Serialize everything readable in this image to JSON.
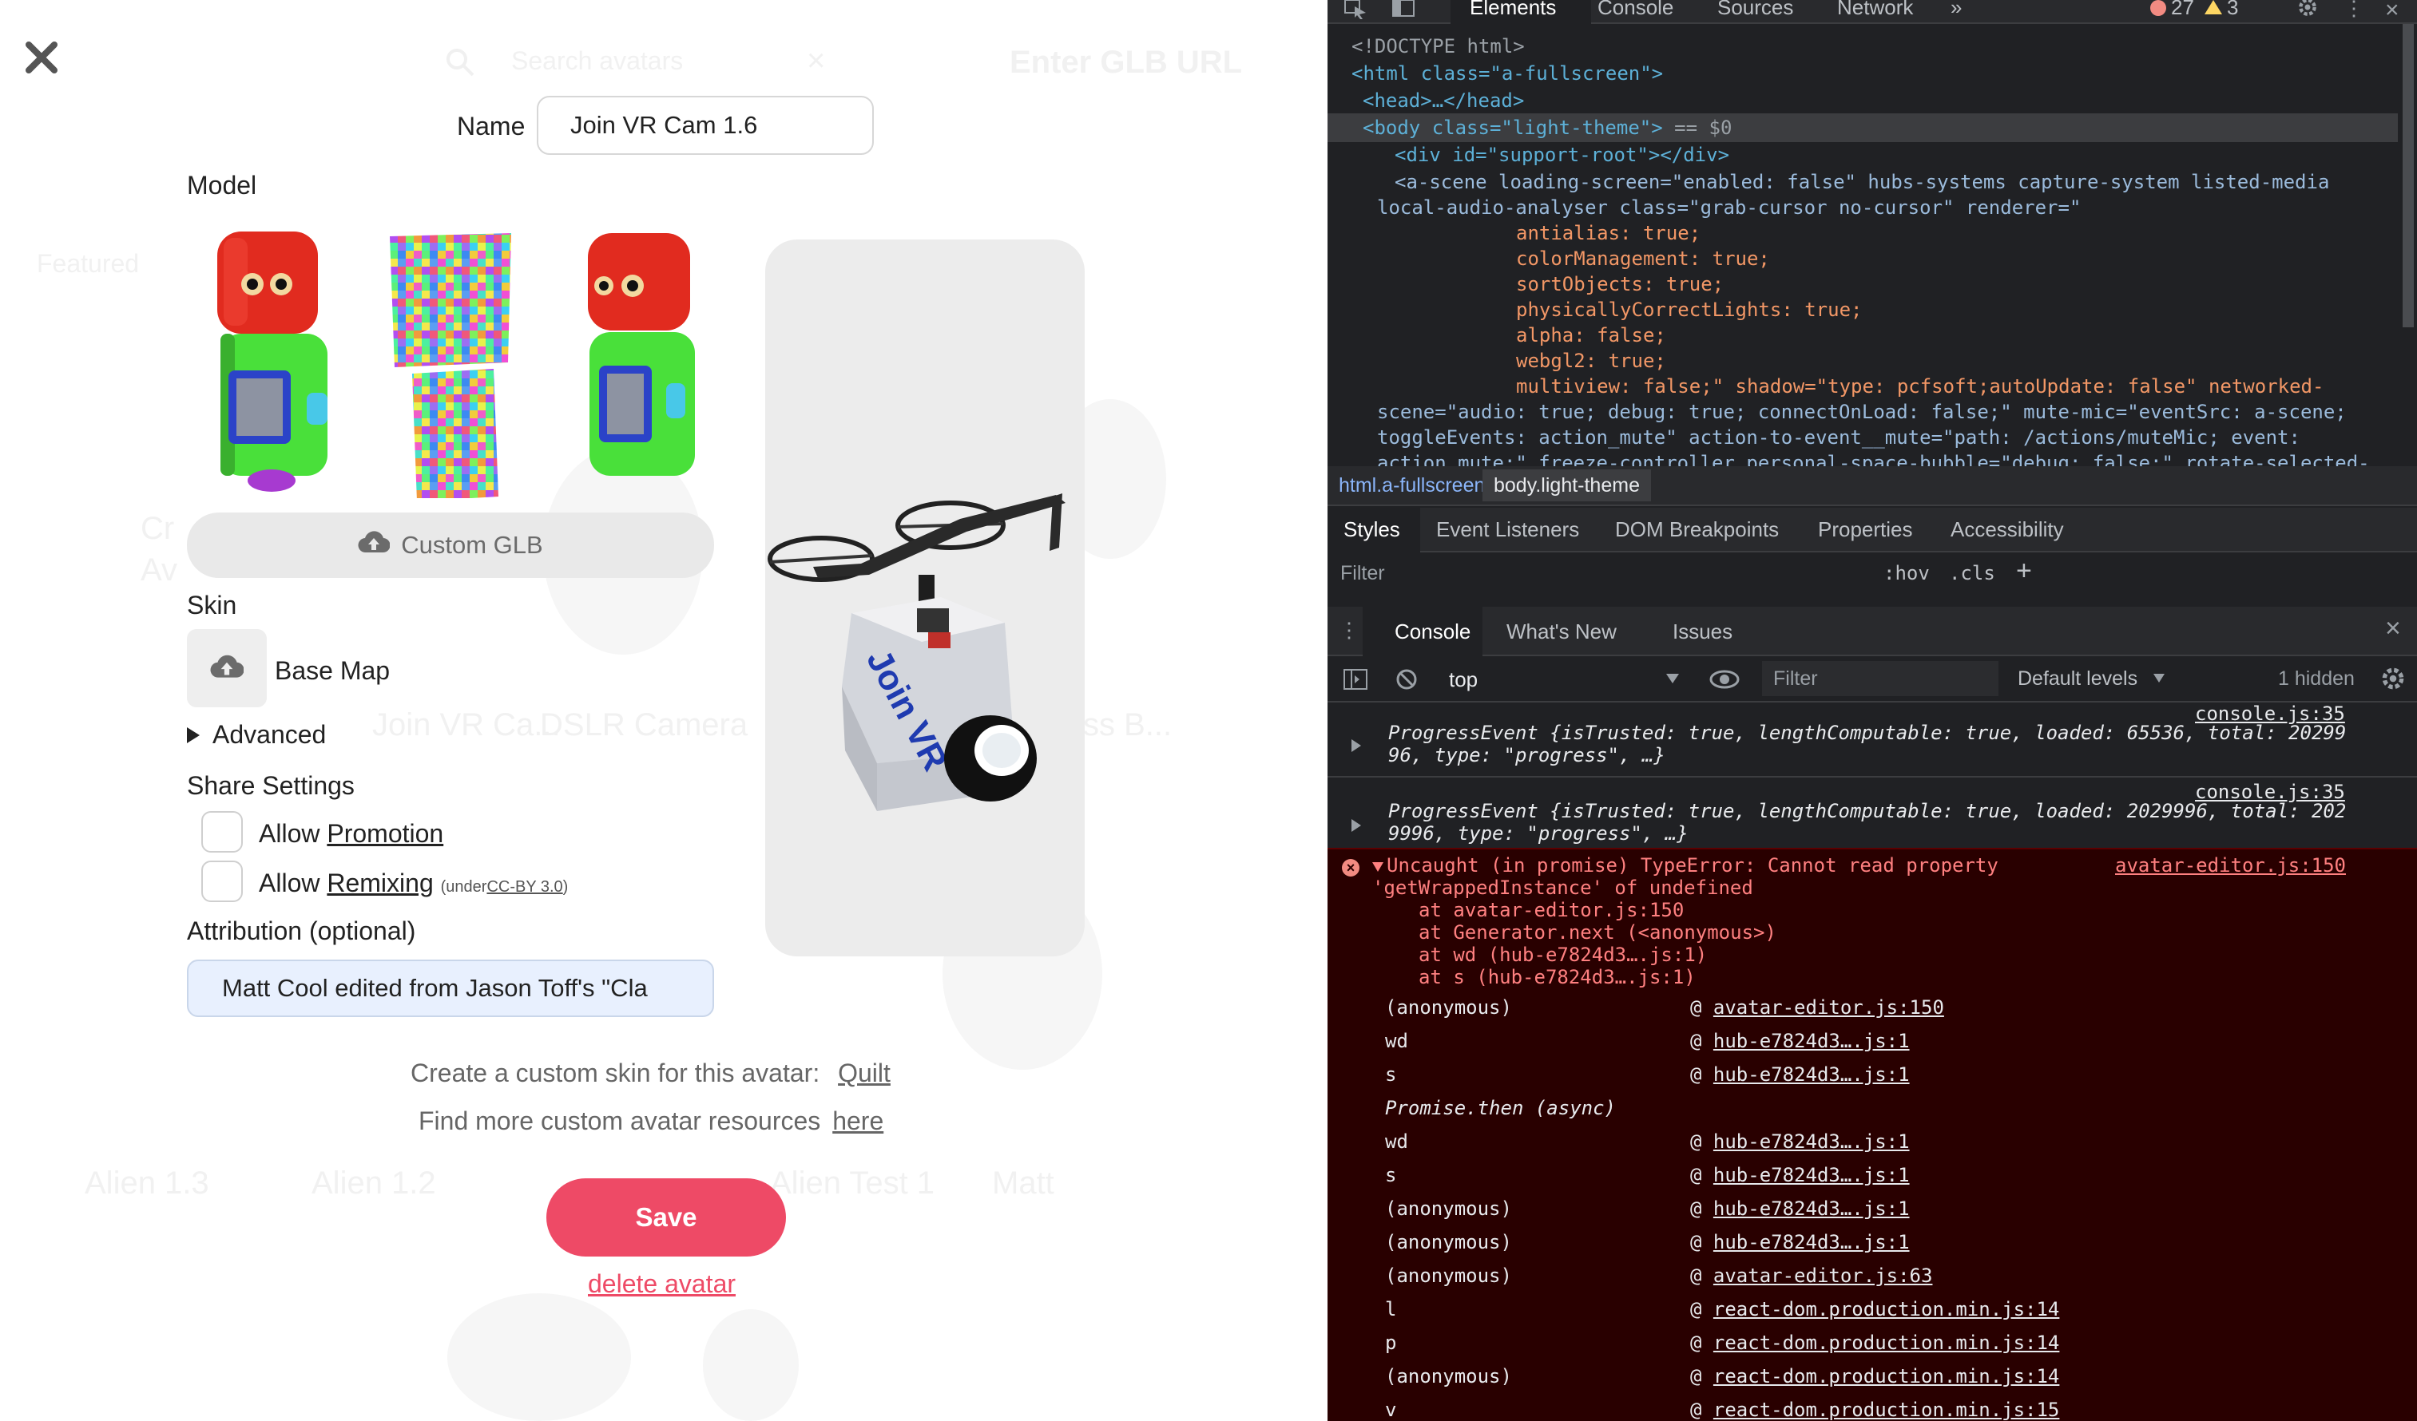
{
  "editor": {
    "name_label": "Name",
    "name_value": "Join VR Cam 1.6",
    "model_label": "Model",
    "custom_glb_label": "Custom GLB",
    "skin_label": "Skin",
    "base_map_label": "Base Map",
    "advanced_label": "Advanced",
    "share_settings_label": "Share Settings",
    "allow_label": "Allow",
    "promotion_label": "Promotion",
    "remixing_label": "Remixing",
    "under_label": "(under",
    "license_label": "CC-BY 3.0",
    "close_paren": ")",
    "attribution_label": "Attribution (optional)",
    "attribution_value": "Matt Cool edited from Jason Toff's \"Cla",
    "skin_prompt": "Create a custom skin for this avatar:",
    "skin_link": "Quilt",
    "resources_prompt": "Find more custom avatar resources",
    "resources_link": "here",
    "save_label": "Save",
    "delete_label": "delete avatar",
    "preview_label": "Join VR"
  },
  "background_ghost": {
    "search_placeholder": "Search avatars",
    "url_button": "Enter GLB URL",
    "row1": [
      "Join VR Ca...",
      "DSLR Camera",
      "ss B..."
    ],
    "row2": [
      "Alien 1.3",
      "Alien 1.2",
      "Alien Test 1",
      "Matt"
    ],
    "fragments": [
      "Cr",
      "Av",
      "Featured"
    ]
  },
  "devtools": {
    "tabs": [
      "Elements",
      "Console",
      "Sources",
      "Network",
      "»"
    ],
    "error_count": "27",
    "warning_count": "3",
    "elements_lines": {
      "doctype": "<!DOCTYPE html>",
      "html_open": "<html class=\"a-fullscreen\">",
      "head": "<head>…</head>",
      "body": "<body class=\"light-theme\">",
      "body_suffix": "== $0",
      "support_root": "<div id=\"support-root\"></div>",
      "scene1": "<a-scene loading-screen=\"enabled: false\" hubs-systems capture-system listed-media",
      "scene2": "local-audio-analyser class=\"grab-cursor no-cursor\" renderer=\"",
      "r1": "antialias: true;",
      "r2": "colorManagement: true;",
      "r3": "sortObjects: true;",
      "r4": "physicallyCorrectLights: true;",
      "r5": "alpha: false;",
      "r6": "webgl2: true;",
      "r7": "multiview: false;\" shadow=\"type: pcfsoft;autoUpdate: false\" networked-",
      "r8": "scene=\"audio: true; debug: true; connectOnLoad: false;\" mute-mic=\"eventSrc: a-scene;",
      "r9": "toggleEvents: action_mute\" action-to-event__mute=\"path: /actions/muteMic; event:",
      "r10": "action_mute;\" freeze-controller personal-space-bubble=\"debug: false;\" rotate-selected-"
    },
    "breadcrumbs": [
      "html.a-fullscreen",
      "body.light-theme"
    ],
    "panel_tabs": [
      "Styles",
      "Event Listeners",
      "DOM Breakpoints",
      "Properties",
      "Accessibility"
    ],
    "filter_placeholder": "Filter",
    "hov": ":hov",
    "cls": ".cls",
    "drawer_tabs": [
      "Console",
      "What's New",
      "Issues"
    ],
    "context": "top",
    "console_filter_placeholder": "Filter",
    "levels": "Default levels",
    "hidden": "1 hidden",
    "console": {
      "src1": "console.js:35",
      "p1a": "ProgressEvent {isTrusted: true, lengthComputable: true, loaded: 65536, total: 20299",
      "p1b": "96, type: \"progress\", …}",
      "src2": "console.js:35",
      "p2a": "ProgressEvent {isTrusted: true, lengthComputable: true, loaded: 2029996, total: 202",
      "p2b": "9996, type: \"progress\", …}",
      "err1": "Uncaught (in promise) TypeError: Cannot read property",
      "err_src": "avatar-editor.js:150",
      "err2": "'getWrappedInstance' of undefined",
      "at1": "at avatar-editor.js:150",
      "at2": "at Generator.next (<anonymous>)",
      "at3": "at wd (hub-e7824d3….js:1)",
      "at4": "at s (hub-e7824d3….js:1)",
      "stack": [
        {
          "name": "(anonymous)",
          "src": "avatar-editor.js:150"
        },
        {
          "name": "wd",
          "src": "hub-e7824d3….js:1"
        },
        {
          "name": "s",
          "src": "hub-e7824d3….js:1"
        },
        {
          "name": "Promise.then (async)",
          "src": ""
        },
        {
          "name": "wd",
          "src": "hub-e7824d3….js:1"
        },
        {
          "name": "s",
          "src": "hub-e7824d3….js:1"
        },
        {
          "name": "(anonymous)",
          "src": "hub-e7824d3….js:1"
        },
        {
          "name": "(anonymous)",
          "src": "hub-e7824d3….js:1"
        },
        {
          "name": "(anonymous)",
          "src": "avatar-editor.js:63"
        },
        {
          "name": "l",
          "src": "react-dom.production.min.js:14"
        },
        {
          "name": "p",
          "src": "react-dom.production.min.js:14"
        },
        {
          "name": "(anonymous)",
          "src": "react-dom.production.min.js:14"
        },
        {
          "name": "v",
          "src": "react-dom.production.min.js:15"
        }
      ]
    }
  }
}
